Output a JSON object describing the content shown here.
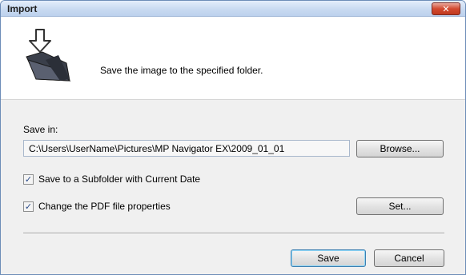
{
  "dialog": {
    "title": "Import",
    "close_icon": "close-x-icon"
  },
  "header": {
    "icon": "import-folder-arrow-icon",
    "description": "Save the image to the specified folder."
  },
  "save_in": {
    "label": "Save in:",
    "path_value": "C:\\Users\\UserName\\Pictures\\MP Navigator EX\\2009_01_01",
    "browse_button": "Browse..."
  },
  "options": {
    "subfolder_checkbox": {
      "label": "Save to a Subfolder with Current Date",
      "checked": true
    },
    "pdf_checkbox": {
      "label": "Change the PDF file properties",
      "checked": true
    },
    "set_button": "Set..."
  },
  "footer": {
    "save_button": "Save",
    "cancel_button": "Cancel"
  }
}
